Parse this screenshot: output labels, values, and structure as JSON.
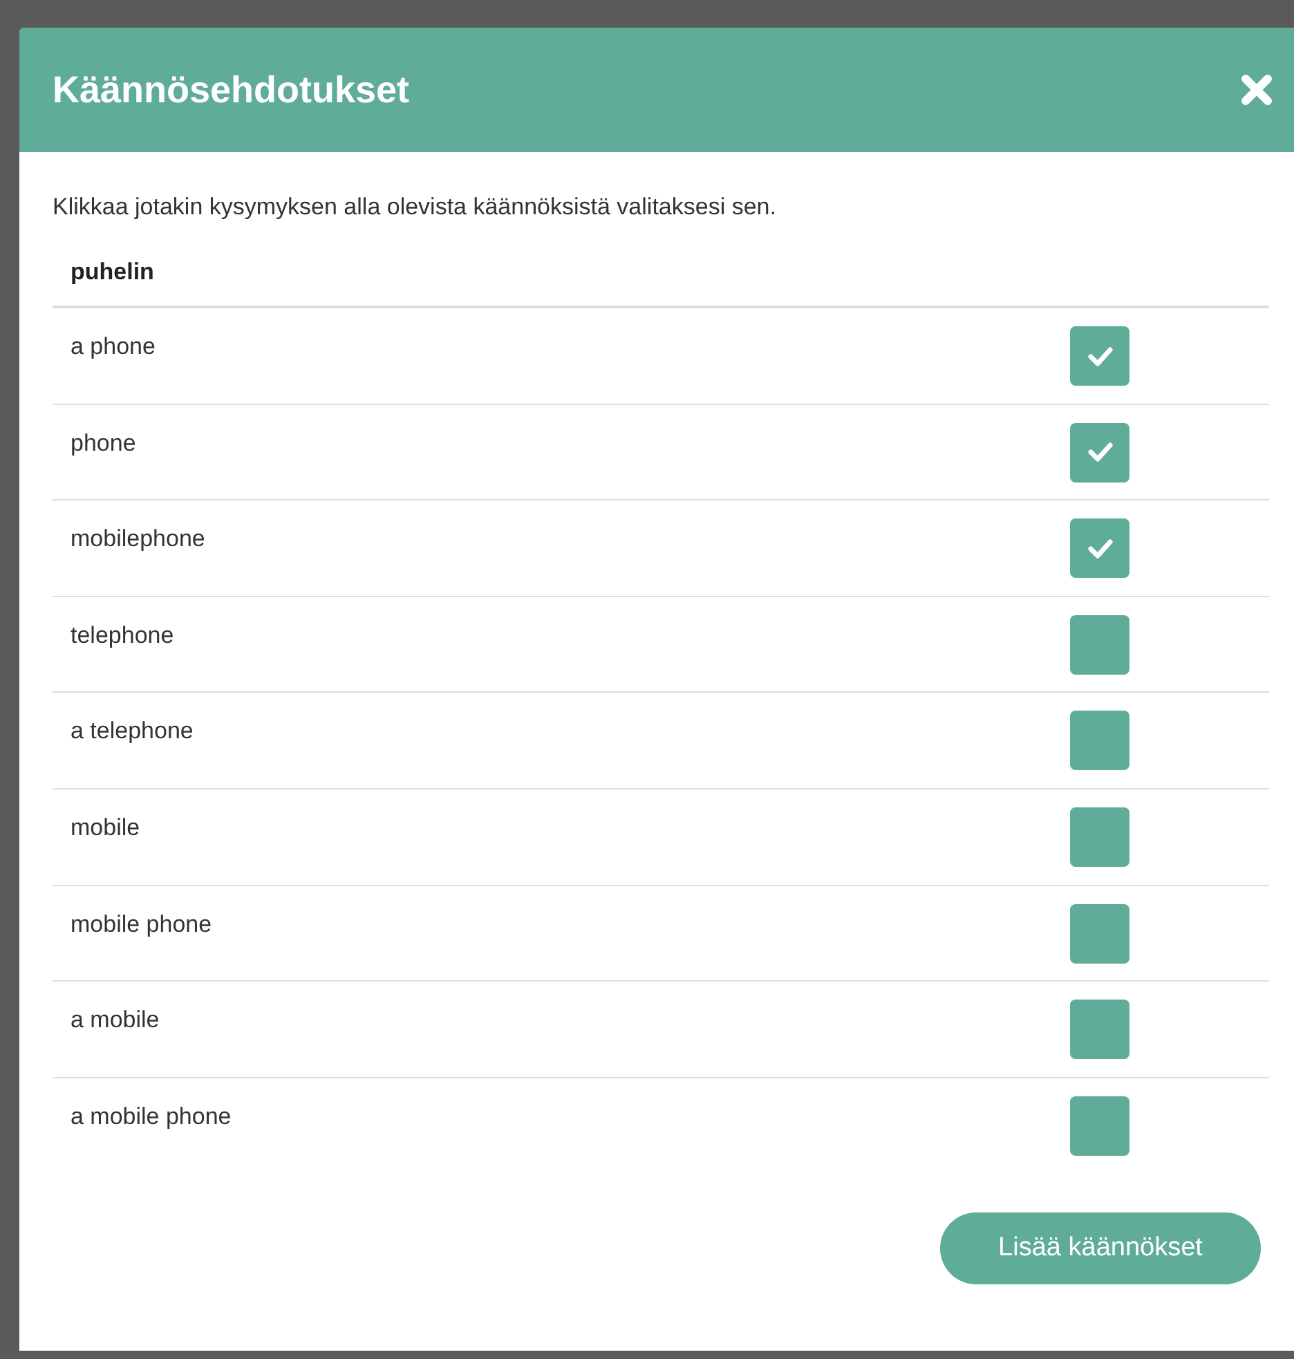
{
  "dialog": {
    "title": "Käännösehdotukset",
    "instructions": "Klikkaa jotakin kysymyksen alla olevista käännöksistä valitaksesi sen.",
    "question": "puhelin",
    "translations": [
      {
        "text": "a phone",
        "checked": true
      },
      {
        "text": "phone",
        "checked": true
      },
      {
        "text": "mobilephone",
        "checked": true
      },
      {
        "text": "telephone",
        "checked": false
      },
      {
        "text": "a telephone",
        "checked": false
      },
      {
        "text": "mobile",
        "checked": false
      },
      {
        "text": "mobile phone",
        "checked": false
      },
      {
        "text": "a mobile",
        "checked": false
      },
      {
        "text": "a mobile phone",
        "checked": false
      }
    ],
    "submit_button": "Lisää käännökset"
  }
}
